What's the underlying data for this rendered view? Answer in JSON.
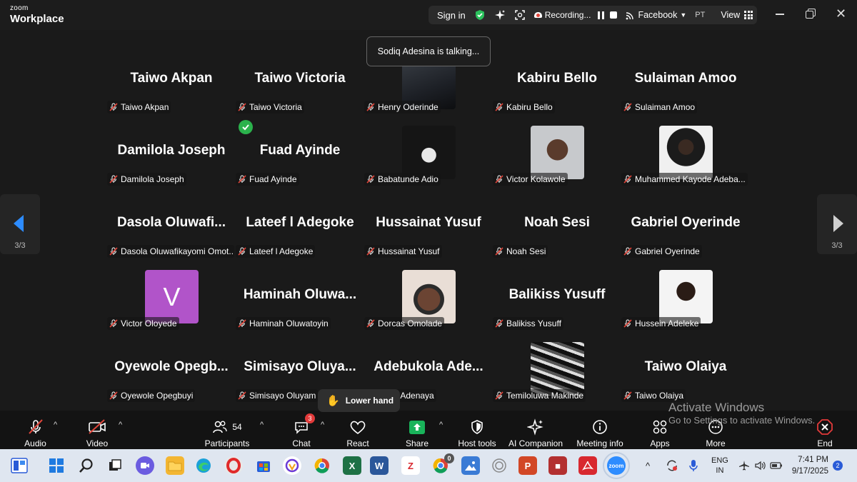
{
  "app": {
    "logo_line1": "zoom",
    "logo_line2": "Workplace"
  },
  "topbar": {
    "sign_in": "Sign in",
    "recording": "Recording...",
    "facebook": "Facebook",
    "pt": "PT",
    "view": "View"
  },
  "talking": "Sodiq Adesina is talking...",
  "page_indicator": "3/3",
  "participants": [
    {
      "big": "Taiwo Akpan",
      "label": "Taiwo Akpan"
    },
    {
      "big": "Taiwo Victoria",
      "label": "Taiwo Victoria"
    },
    {
      "big": "",
      "label": "Henry Oderinde",
      "photo": "dark"
    },
    {
      "big": "Kabiru Bello",
      "label": "Kabiru Bello"
    },
    {
      "big": "Sulaiman Amoo",
      "label": "Sulaiman Amoo"
    },
    {
      "big": "Damilola Joseph",
      "label": "Damilola Joseph"
    },
    {
      "big": "Fuad Ayinde",
      "label": "Fuad Ayinde"
    },
    {
      "big": "",
      "label": "Babatunde Adio",
      "photo": "anime"
    },
    {
      "big": "",
      "label": "Victor Kolawole",
      "photo": "face"
    },
    {
      "big": "",
      "label": "Muhammed  Kayode Adeba...",
      "photo": "portrait"
    },
    {
      "big": "Dasola  Oluwafi...",
      "label": "Dasola Oluwafikayomi Omot..."
    },
    {
      "big": "Lateef l Adegoke",
      "label": "Lateef l Adegoke"
    },
    {
      "big": "Hussainat Yusuf",
      "label": "Hussainat Yusuf"
    },
    {
      "big": "Noah Sesi",
      "label": "Noah Sesi"
    },
    {
      "big": "Gabriel Oyerinde",
      "label": "Gabriel Oyerinde"
    },
    {
      "big": "",
      "label": "Victor Oloyede",
      "photo": "avatar",
      "initial": "V"
    },
    {
      "big": "Haminah  Oluwa...",
      "label": "Haminah Oluwatoyin"
    },
    {
      "big": "",
      "label": "Dorcas Omolade",
      "photo": "selfie"
    },
    {
      "big": "Balikiss Yusuff",
      "label": "Balikiss Yusuff"
    },
    {
      "big": "",
      "label": "Hussein Adeleke",
      "photo": "white"
    },
    {
      "big": "Oyewole  Opegb...",
      "label": "Oyewole Opegbuyi"
    },
    {
      "big": "Simisayo  Oluya...",
      "label": "Simisayo Oluyam"
    },
    {
      "big": "Adebukola  Ade...",
      "label": "ukola Adenaya"
    },
    {
      "big": "",
      "label": "Temiloluwa Makinde",
      "photo": "bw"
    },
    {
      "big": "Taiwo Olaiya",
      "label": "Taiwo Olaiya"
    }
  ],
  "lower_hand": "Lower hand",
  "toolbar": {
    "audio": "Audio",
    "video": "Video",
    "participants": "Participants",
    "participants_count": "54",
    "chat": "Chat",
    "chat_badge": "3",
    "react": "React",
    "share": "Share",
    "host_tools": "Host tools",
    "ai_companion": "AI Companion",
    "meeting_info": "Meeting info",
    "apps": "Apps",
    "more": "More",
    "end": "End"
  },
  "watermark": {
    "line1": "Activate Windows",
    "line2": "Go to Settings to activate Windows."
  },
  "taskbar": {
    "chrome_badge": "0",
    "lang1": "ENG",
    "lang2": "IN",
    "time": "7:41 PM",
    "date": "9/17/2025",
    "notif": "2"
  },
  "colors": {
    "background": "#1a1a1a",
    "share_green": "#19b35a",
    "mute_red": "#e0453a",
    "avatar_purple": "#b154c9",
    "end_red": "#e23a3a"
  }
}
